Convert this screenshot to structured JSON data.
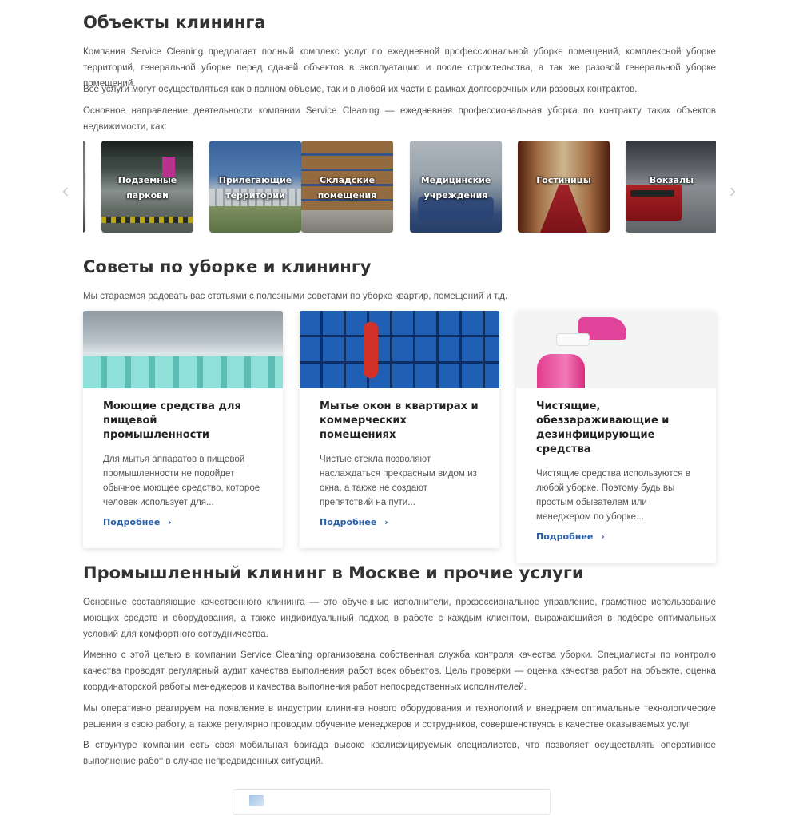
{
  "objects": {
    "title": "Объекты клининга",
    "paragraphs": [
      "Компания Service Cleaning предлагает полный комплекс услуг по ежедневной профессиональной уборке помещений, комплексной уборке территорий, генеральной уборке перед сдачей объектов в эксплуатацию и после строительства, а так же разовой генеральной уборке помещений.",
      "Все услуги могут осуществляться как в полном объеме, так и в любой их части в рамках долгосрочных или разовых контрактов.",
      "Основное направление деятельности компании Service Cleaning — ежедневная профессиональная уборка по контракту таких объектов недвижимости, как:"
    ],
    "carousel": [
      {
        "label": "Подземные паркови",
        "icon": "parking-photo"
      },
      {
        "label": "Прилегающие территории",
        "icon": "territory-photo"
      },
      {
        "label": "Складские помещения",
        "icon": "warehouse-photo"
      },
      {
        "label": "Медицинские учреждения",
        "icon": "hospital-photo"
      },
      {
        "label": "Гостиницы",
        "icon": "hotel-photo"
      },
      {
        "label": "Вокзалы",
        "icon": "station-photo"
      }
    ],
    "prev_arrow": "‹",
    "next_arrow": "›"
  },
  "tips": {
    "title": "Советы по уборке и клинингу",
    "intro": "Мы стараемся радовать вас статьями с полезными советами по уборке квартир, помещений и т.д.",
    "cards": [
      {
        "title": "Моющие средства для пищевой промышленности",
        "excerpt": "Для мытья аппаратов в пищевой промышленности не подойдет обычное моющее средство, которое человек использует для...",
        "more": "Подробнее",
        "image": "detergent-bottles-photo"
      },
      {
        "title": "Мытье окон в квартирах и коммерческих помещениях",
        "excerpt": "Чистые стекла позволяют наслаждаться прекрасным видом из окна, а также не создают препятствий на пути...",
        "more": "Подробнее",
        "image": "window-washer-photo"
      },
      {
        "title": "Чистящие, обеззараживающие и дезинфицирующие средства",
        "excerpt": "Чистящие средства используются в любой уборке. Поэтому будь вы простым обывателем или менеджером по уборке...",
        "more": "Подробнее",
        "image": "spray-bottle-photo"
      }
    ],
    "more_chevron": "›"
  },
  "industrial": {
    "title": "Промышленный клининг в Москве и прочие услуги",
    "paragraphs": [
      "Основные составляющие качественного клининга — это обученные исполнители, профессиональное управление, грамотное использование моющих средств и оборудования, а также индивидуальный подход в работе с каждым клиентом, выражающийся в подборе оптимальных условий для комфортного сотрудничества.",
      "Именно с этой целью в компании Service Cleaning организована собственная служба контроля качества уборки. Специалисты по контролю качества проводят регулярный аудит качества выполнения работ всех объектов. Цель проверки — оценка качества работ на объекте, оценка координаторской работы менеджеров и качества выполнения работ непосредственных исполнителей.",
      "Мы оперативно реагируем на появление в индустрии клининга нового оборудования и технологий и внедряем оптимальные технологические решения в свою работу, а также регулярно проводим обучение менеджеров и сотрудников, совершенствуясь в качестве оказываемых услуг.",
      "В структуре компании есть своя мобильная бригада высоко квалифицируемых специалистов, что позволяет осуществлять оперативное выполнение работ в случае непредвиденных ситуаций."
    ]
  }
}
